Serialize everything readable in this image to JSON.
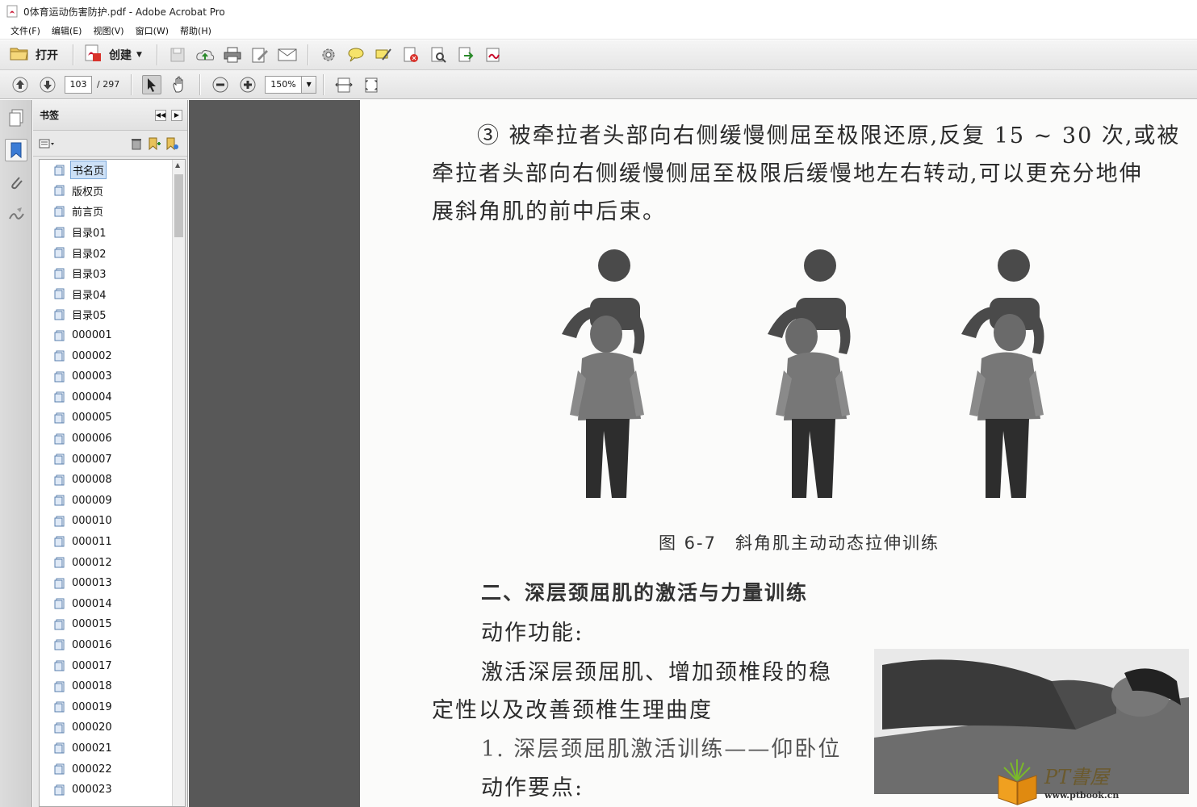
{
  "window": {
    "title": "0体育运动伤害防护.pdf - Adobe Acrobat Pro"
  },
  "menu": [
    "文件(F)",
    "编辑(E)",
    "视图(V)",
    "窗口(W)",
    "帮助(H)"
  ],
  "toolbar": {
    "open_label": "打开",
    "create_label": "创建"
  },
  "navigation": {
    "current_page": "103",
    "total_pages": "/ 297",
    "zoom": "150%"
  },
  "bookmarks": {
    "title": "书签",
    "items": [
      "书名页",
      "版权页",
      "前言页",
      "目录01",
      "目录02",
      "目录03",
      "目录04",
      "目录05",
      "000001",
      "000002",
      "000003",
      "000004",
      "000005",
      "000006",
      "000007",
      "000008",
      "000009",
      "000010",
      "000011",
      "000012",
      "000013",
      "000014",
      "000015",
      "000016",
      "000017",
      "000018",
      "000019",
      "000020",
      "000021",
      "000022",
      "000023"
    ],
    "selected_index": 0
  },
  "document": {
    "line1": "③ 被牵拉者头部向右侧缓慢侧屈至极限还原,反复 15 ~ 30 次,或被",
    "line2": "牵拉者头部向右侧缓慢侧屈至极限后缓慢地左右转动,可以更充分地伸",
    "line3": "展斜角肌的前中后束。",
    "figure_caption": "图 6-7　斜角肌主动动态拉伸训练",
    "section_heading": "二、深层颈屈肌的激活与力量训练",
    "function_label": "动作功能:",
    "function_line1": "激活深层颈屈肌、增加颈椎段的稳",
    "function_line2": "定性以及改善颈椎生理曲度",
    "exercise_title": "1. 深层颈屈肌激活训练——仰卧位",
    "essentials_label": "动作要点:"
  },
  "watermark": {
    "brand": "PT書屋",
    "url": "www.ptbook.cn"
  }
}
